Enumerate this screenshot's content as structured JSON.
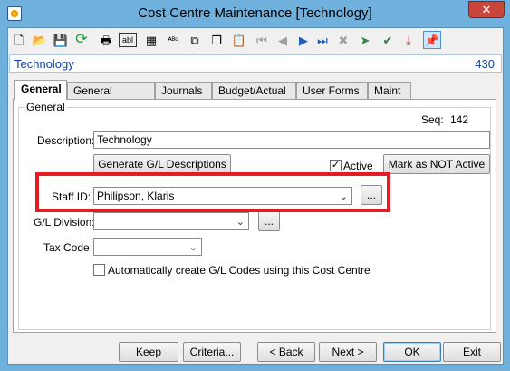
{
  "window": {
    "title": "Cost Centre Maintenance  [Technology]",
    "close_glyph": "✕"
  },
  "toolbar": {
    "icons": [
      "new-icon",
      "open-folder-icon",
      "save-icon",
      "refresh-icon",
      "print-icon",
      "text-field-icon",
      "calculator-icon",
      "spell-check-icon",
      "copy-icon",
      "paste-icon",
      "first-record-icon",
      "previous-record-icon",
      "next-record-icon",
      "last-record-icon",
      "delete-icon",
      "navigate-icon",
      "stamp-icon",
      "export-icon",
      "pin-icon"
    ]
  },
  "header": {
    "title": "Technology",
    "code": "430"
  },
  "tabs": [
    {
      "label": "General",
      "active": true
    },
    {
      "label": "General Ledger",
      "active": false
    },
    {
      "label": "Journals",
      "active": false
    },
    {
      "label": "Budget/Actual",
      "active": false
    },
    {
      "label": "User Forms",
      "active": false
    },
    {
      "label": "Maint",
      "active": false
    }
  ],
  "general": {
    "group_label": "General",
    "seq_label": "Seq:",
    "seq_value": "142",
    "description_label": "Description:",
    "description_value": "Technology",
    "generate_button": "Generate G/L Descriptions",
    "active_label": "Active",
    "active_checked": true,
    "mark_inactive_button": "Mark as NOT Active",
    "staff_label": "Staff ID:",
    "staff_value": "Philipson, Klaris",
    "ellipsis": "...",
    "gl_division_label": "G/L Division:",
    "gl_division_value": "",
    "tax_code_label": "Tax Code:",
    "tax_code_value": "",
    "auto_create_label": "Automatically create G/L Codes using this Cost Centre",
    "auto_create_checked": false
  },
  "footer": {
    "keep": "Keep",
    "criteria": "Criteria...",
    "back": "< Back",
    "next": "Next >",
    "ok": "OK",
    "exit": "Exit"
  },
  "colors": {
    "frame": "#6fb0dc",
    "highlight": "#e31c23",
    "header_text": "#0f3fa8"
  }
}
